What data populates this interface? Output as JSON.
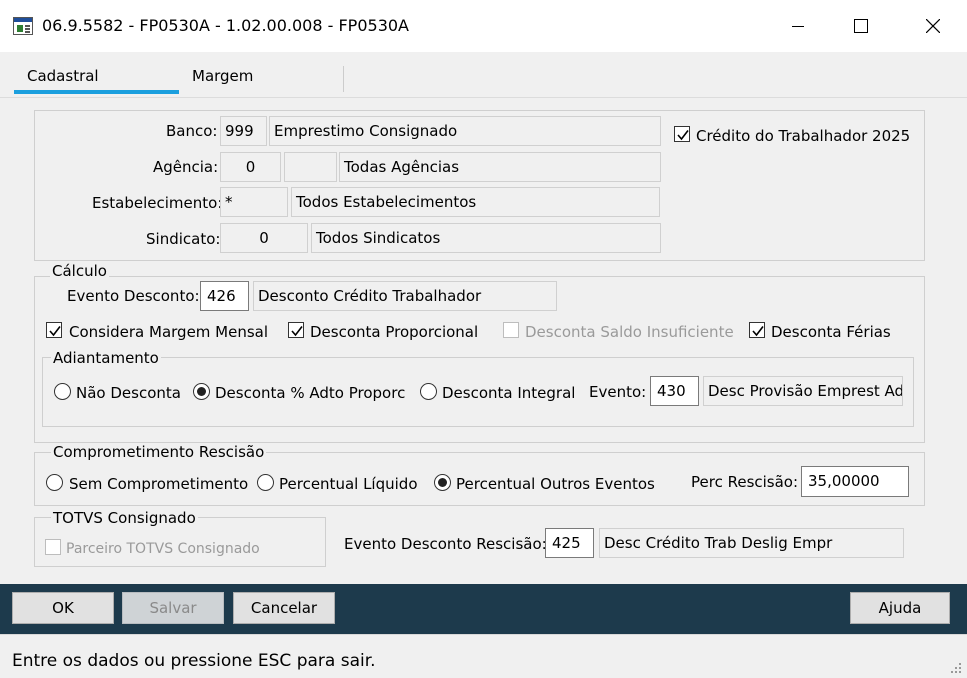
{
  "window": {
    "title": "06.9.5582 - FP0530A - 1.02.00.008 - FP0530A"
  },
  "tabs": [
    {
      "label": "Cadastral",
      "active": true
    },
    {
      "label": "Margem",
      "active": false
    }
  ],
  "top": {
    "banco": {
      "label": "Banco:",
      "code": "999",
      "description": "Emprestimo Consignado"
    },
    "agencia": {
      "label": "Agência:",
      "code": "0",
      "digit": "",
      "description": "Todas Agências"
    },
    "estabelecimento": {
      "label": "Estabelecimento:",
      "code": "*",
      "description": "Todos Estabelecimentos"
    },
    "sindicato": {
      "label": "Sindicato:",
      "code": "0",
      "description": "Todos Sindicatos"
    },
    "credito_trabalhador": {
      "label": "Crédito do Trabalhador 2025",
      "checked": true
    }
  },
  "calculo": {
    "legend": "Cálculo",
    "evento_desconto": {
      "label": "Evento Desconto:",
      "code": "426",
      "description": "Desconto Crédito Trabalhador"
    },
    "checks": [
      {
        "label": "Considera Margem Mensal",
        "checked": true,
        "enabled": true
      },
      {
        "label": "Desconta Proporcional",
        "checked": true,
        "enabled": true
      },
      {
        "label": "Desconta Saldo Insuficiente",
        "checked": false,
        "enabled": false
      },
      {
        "label": "Desconta Férias",
        "checked": true,
        "enabled": true
      }
    ],
    "adiantamento": {
      "legend": "Adiantamento",
      "options": [
        {
          "label": "Não Desconta",
          "selected": false
        },
        {
          "label": "Desconta % Adto Proporc",
          "selected": true
        },
        {
          "label": "Desconta Integral",
          "selected": false
        }
      ],
      "evento": {
        "label": "Evento:",
        "code": "430",
        "description": "Desc Provisão Emprest Adt"
      }
    }
  },
  "rescisao": {
    "legend": "Comprometimento Rescisão",
    "options": [
      {
        "label": "Sem Comprometimento",
        "selected": false
      },
      {
        "label": "Percentual Líquido",
        "selected": false
      },
      {
        "label": "Percentual Outros Eventos",
        "selected": true
      }
    ],
    "perc": {
      "label": "Perc Rescisão:",
      "value": "35,00000"
    }
  },
  "totvs": {
    "legend": "TOTVS Consignado",
    "parceiro": {
      "label": "Parceiro TOTVS Consignado",
      "checked": false,
      "enabled": false
    },
    "evento_rescisao": {
      "label": "Evento Desconto Rescisão:",
      "code": "425",
      "description": "Desc Crédito Trab Deslig Empr"
    }
  },
  "buttons": {
    "ok": "OK",
    "salvar": "Salvar",
    "cancelar": "Cancelar",
    "ajuda": "Ajuda"
  },
  "status": {
    "text": "Entre os dados ou pressione ESC para sair."
  },
  "colors": {
    "tab_accent": "#1b9fde",
    "footer_bar": "#1d3a4c",
    "panel_bg": "#f0f0f0"
  },
  "icons": {
    "app": "app-window-icon",
    "minimize": "minimize-icon",
    "maximize": "maximize-icon",
    "close": "close-icon",
    "check": "check-icon",
    "grip": "resize-grip-icon"
  }
}
